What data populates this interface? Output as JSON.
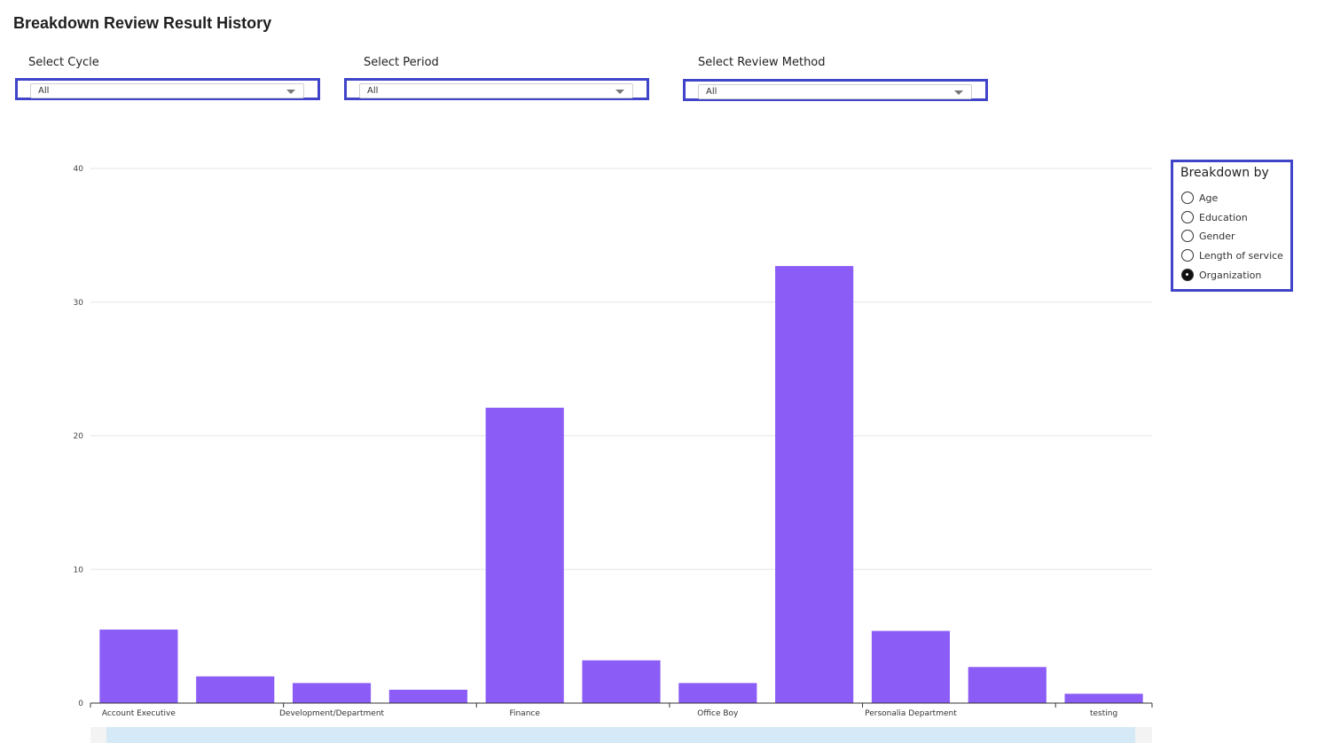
{
  "page": {
    "title": "Breakdown Review Result History"
  },
  "filters": [
    {
      "label": "Select Cycle",
      "value": "All"
    },
    {
      "label": "Select Period",
      "value": "All"
    },
    {
      "label": "Select Review Method",
      "value": "All"
    }
  ],
  "breakdown": {
    "title": "Breakdown by",
    "options": [
      {
        "label": "Age",
        "checked": false
      },
      {
        "label": "Education",
        "checked": false
      },
      {
        "label": "Gender",
        "checked": false
      },
      {
        "label": "Length of service",
        "checked": false
      },
      {
        "label": "Organization",
        "checked": true
      }
    ]
  },
  "colors": {
    "bar": "#8b5cf6",
    "filter_border": "#3f44c8",
    "grid": "#e6e6e6"
  },
  "chart_data": {
    "type": "bar",
    "title": "",
    "xlabel": "",
    "ylabel": "",
    "ylim": [
      0,
      40
    ],
    "yticks": [
      0,
      10,
      20,
      30,
      40
    ],
    "grid": true,
    "categories": [
      "Account Executive",
      "",
      "Development/Department",
      "",
      "Finance",
      "",
      "Office Boy",
      "",
      "Personalia Department",
      "",
      "testing"
    ],
    "values": [
      5.5,
      2.0,
      1.5,
      1.0,
      22.1,
      3.2,
      1.5,
      32.7,
      5.4,
      2.7,
      0.7
    ]
  }
}
